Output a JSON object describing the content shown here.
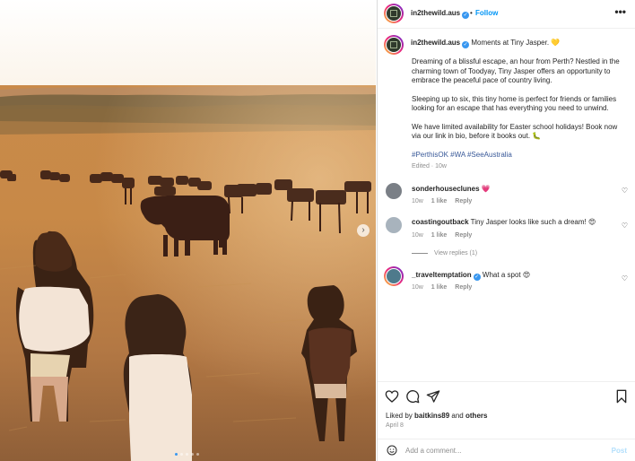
{
  "post": {
    "slide_count": 5,
    "active_slide": 1,
    "next_glyph": "›"
  },
  "header": {
    "username": "in2thewild.aus",
    "separator": "•",
    "follow_label": "Follow",
    "more_glyph": "•••"
  },
  "caption": {
    "username": "in2thewild.aus",
    "headline": "Moments at Tiny Jasper.",
    "headline_emoji": "💛",
    "paragraphs": [
      "Dreaming of a blissful escape, an hour from Perth? Nestled in the charming town of Toodyay, Tiny Jasper offers an opportunity to embrace the peaceful pace of country living.",
      "Sleeping up to six, this tiny home is perfect for friends or families looking for an escape that has everything you need to unwind.",
      "We have limited availability for Easter school holidays! Book now via our link in bio, before it books out. 🐛"
    ],
    "hashtags": [
      "#PerthisOK",
      "#WA",
      "#SeeAustralia"
    ],
    "edited": "Edited · 10w"
  },
  "comments": [
    {
      "username": "sonderhouseclunes",
      "text": "💗",
      "time": "10w",
      "likes": "1 like",
      "reply_label": "Reply",
      "avatar_color": "#7a7f86"
    },
    {
      "username": "coastingoutback",
      "text": "Tiny Jasper looks like such a dream! 😍",
      "time": "10w",
      "likes": "1 like",
      "reply_label": "Reply",
      "avatar_color": "#a8b3bd"
    },
    {
      "username": "_traveltemptation",
      "text": "What a spot 😍",
      "time": "10w",
      "likes": "1 like",
      "reply_label": "Reply",
      "avatar_color": "#4e7a8c"
    }
  ],
  "view_replies": "View replies (1)",
  "likes": {
    "prefix": "Liked by",
    "user": "baitkins89",
    "mid": "and",
    "others": "others"
  },
  "date": "April 8",
  "add_comment": {
    "placeholder": "Add a comment...",
    "post_label": "Post"
  },
  "colors": {
    "accent": "#0095f6",
    "verified": "#3897f0",
    "hashtag": "#385898",
    "muted": "#8e8e8e"
  }
}
